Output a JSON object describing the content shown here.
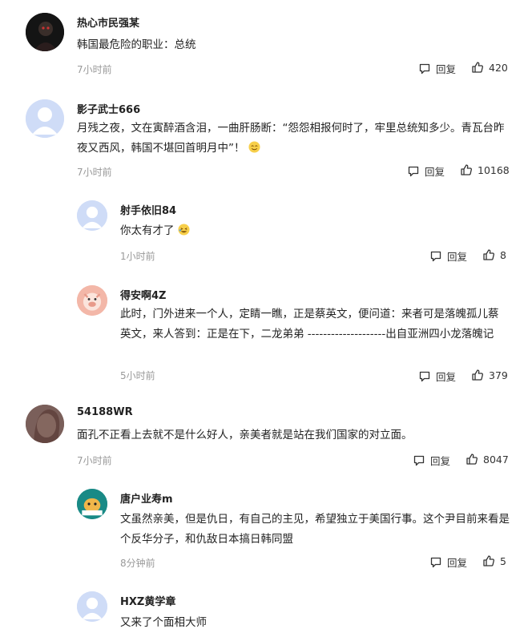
{
  "actions": {
    "reply_label": "回复"
  },
  "comments": [
    {
      "user": "热心市民强某",
      "text": "韩国最危险的职业：总统",
      "time": "7小时前",
      "likes": "420",
      "avatar": "dark-avatar"
    },
    {
      "user": "影子武士666",
      "text": "月残之夜，文在寅醉酒含泪，一曲肝肠断：“怨怨相报何时了，牢里总统知多少。青瓦台昨夜又西风，韩国不堪回首明月中”！",
      "time": "7小时前",
      "likes": "10168",
      "avatar": "default-avatar",
      "emoji": "smile-emoji-icon"
    },
    {
      "user": "射手依旧84",
      "text": "你太有才了",
      "time": "1小时前",
      "likes": "8",
      "avatar": "default-avatar",
      "emoji": "laughing-emoji-icon"
    },
    {
      "user": "得安啊4Z",
      "text": "此时，门外进来一个人，定睛一瞧，正是蔡英文，便问道：来者可是落魄孤儿蔡英文，来人答到：正是在下，二龙弟弟 --------------------出自亚洲四小龙落魄记",
      "time": "5小时前",
      "likes": "379",
      "avatar": "pig-avatar"
    },
    {
      "user": "54188WR",
      "text": "面孔不正看上去就不是什么好人，亲美者就是站在我们国家的对立面。",
      "time": "7小时前",
      "likes": "8047",
      "avatar": "photo-avatar"
    },
    {
      "user": "唐户业寿m",
      "text": "文虽然亲美，但是仇日，有自己的主见，希望独立于美国行事。这个尹目前来看是个反华分子，和仇敌日本搞日韩同盟",
      "time": "8分钟前",
      "likes": "5",
      "avatar": "cartoon-avatar"
    },
    {
      "user": "HXZ黄学章",
      "text": "又来了个面相大师",
      "time": "",
      "likes": "",
      "avatar": "default-avatar"
    }
  ]
}
